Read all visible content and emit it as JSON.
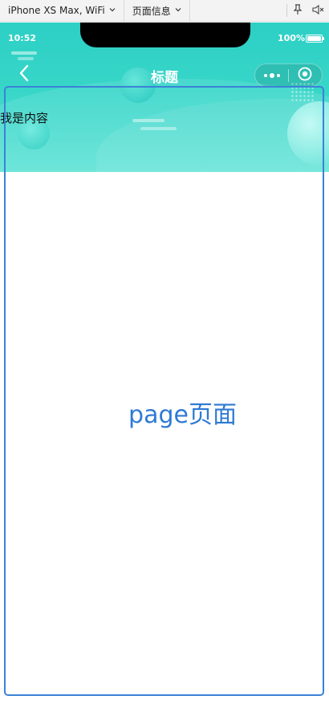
{
  "toolbar": {
    "device_label": "iPhone XS Max, WiFi",
    "page_info_label": "页面信息",
    "pin_icon": "pin-icon",
    "mute_icon": "speaker-mute-icon"
  },
  "status_bar": {
    "time": "10:52",
    "battery_percent": "100%"
  },
  "nav": {
    "title": "标题",
    "back_icon": "chevron-left-icon",
    "menu_icon": "more-dots-icon",
    "close_icon": "target-circle-icon"
  },
  "content": {
    "text": "我是内容"
  },
  "page": {
    "label": "page页面"
  },
  "colors": {
    "header_gradient_top": "#2dcfc4",
    "header_gradient_bottom": "#5ee2d5",
    "page_outline": "#3b82d6",
    "page_label": "#2f7ad4"
  }
}
